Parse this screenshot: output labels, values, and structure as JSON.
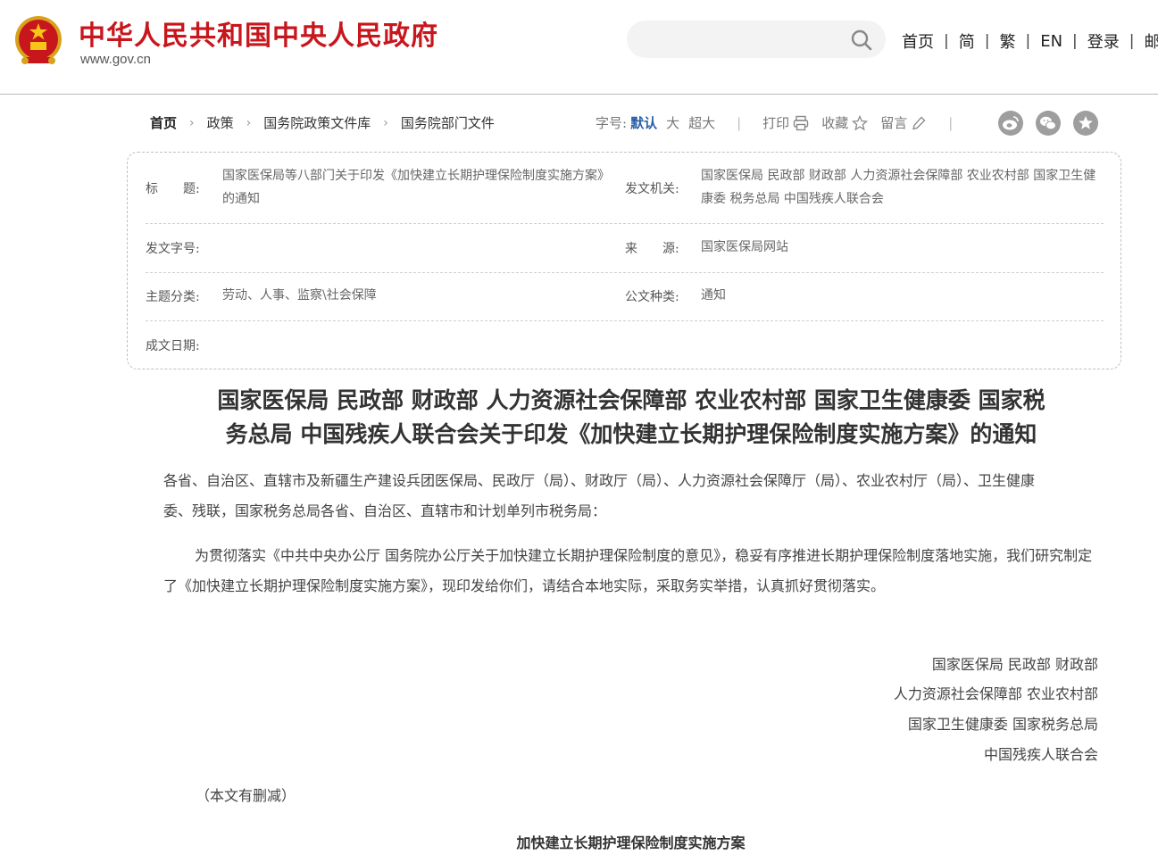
{
  "header": {
    "site_name": "中华人民共和国中央人民政府",
    "site_url": "www.gov.cn",
    "nav": [
      "首页",
      "简",
      "繁",
      "EN",
      "登录",
      "邮箱"
    ],
    "search_placeholder": ""
  },
  "breadcrumb": [
    "首页",
    "政策",
    "国务院政策文件库",
    "国务院部门文件"
  ],
  "tools": {
    "font_size_label": "字号:",
    "font_sizes": [
      "默认",
      "大",
      "超大"
    ],
    "print": "打印",
    "favorite": "收藏",
    "comment": "留言"
  },
  "info": {
    "title_label": "标　　题:",
    "title_value": "国家医保局等八部门关于印发《加快建立长期护理保险制度实施方案》的通知",
    "issuer_label": "发文机关:",
    "issuer_value": "国家医保局 民政部 财政部 人力资源社会保障部 农业农村部 国家卫生健康委 税务总局 中国残疾人联合会",
    "doc_no_label": "发文字号:",
    "doc_no_value": "",
    "source_label": "来　　源:",
    "source_value": "国家医保局网站",
    "topic_label": "主题分类:",
    "topic_value": "劳动、人事、监察\\社会保障",
    "type_label": "公文种类:",
    "type_value": "通知",
    "date_label": "成文日期:",
    "date_value": ""
  },
  "document": {
    "title_line1": "国家医保局 民政部 财政部 人力资源社会保障部 农业农村部 国家卫生健康委 国家税",
    "title_line2": "务总局 中国残疾人联合会关于印发《加快建立长期护理保险制度实施方案》的通知",
    "addressee": "各省、自治区、直辖市及新疆生产建设兵团医保局、民政厅（局）、财政厅（局）、人力资源社会保障厅（局）、农业农村厅（局）、卫生健康委、残联，国家税务总局各省、自治区、直辖市和计划单列市税务局：",
    "body": "为贯彻落实《中共中央办公厅 国务院办公厅关于加快建立长期护理保险制度的意见》，稳妥有序推进长期护理保险制度落地实施，我们研究制定了《加快建立长期护理保险制度实施方案》，现印发给你们，请结合本地实际，采取务实举措，认真抓好贯彻落实。",
    "signatures": [
      "国家医保局 民政部 财政部",
      "人力资源社会保障部 农业农村部",
      "国家卫生健康委 国家税务总局",
      "中国残疾人联合会"
    ],
    "note": "（本文有删减）",
    "attachment_title": "加快建立长期护理保险制度实施方案"
  },
  "colors": {
    "brand_red": "#c8161d",
    "link_blue": "#2a5fa8"
  },
  "icons": [
    "national-emblem-icon",
    "search-icon",
    "print-icon",
    "star-icon",
    "pencil-icon",
    "weibo-icon",
    "wechat-icon",
    "favorite-share-icon"
  ]
}
